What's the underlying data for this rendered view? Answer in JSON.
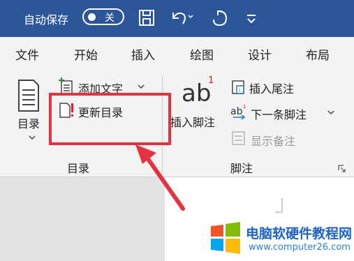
{
  "titlebar": {
    "autosave_label": "自动保存",
    "autosave_state": "关",
    "bg_color": "#2b579a"
  },
  "tabs": [
    "文件",
    "开始",
    "插入",
    "绘图",
    "设计",
    "布局"
  ],
  "ribbon": {
    "toc_group": {
      "toc_button": "目录",
      "add_text": "添加文字",
      "update_toc": "更新目录",
      "group_label": "目录"
    },
    "footnote_group": {
      "insert_footnote": "插入脚注",
      "insert_endnote": "插入尾注",
      "next_footnote": "下一条脚注",
      "show_notes": "显示备注",
      "group_label": "脚注"
    }
  },
  "icons": [
    "save-icon",
    "undo-icon",
    "redo-icon",
    "customize-icon",
    "toc-icon",
    "add-text-icon",
    "update-toc-icon",
    "insert-footnote-icon",
    "insert-endnote-icon",
    "next-footnote-icon",
    "show-notes-icon",
    "dialog-launcher-icon"
  ],
  "annotation": {
    "highlight_color": "#e8313f"
  },
  "watermark": {
    "site_name": "电脑软硬件教程网",
    "url": "www.computer26.com"
  }
}
